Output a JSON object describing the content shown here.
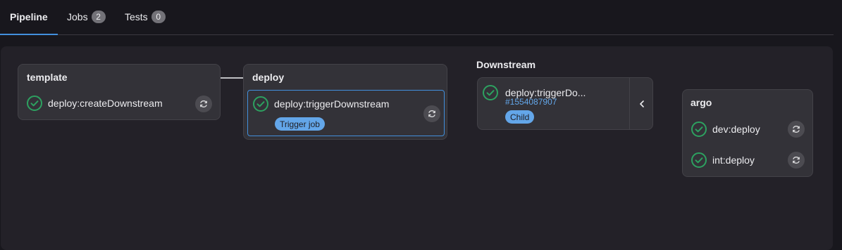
{
  "tabs": [
    {
      "label": "Pipeline",
      "active": true
    },
    {
      "label": "Jobs",
      "count": "2"
    },
    {
      "label": "Tests",
      "count": "0"
    }
  ],
  "stages": {
    "template": {
      "title": "template",
      "jobs": [
        {
          "label": "deploy:createDownstream",
          "status": "success"
        }
      ]
    },
    "deploy": {
      "title": "deploy",
      "jobs": [
        {
          "label": "deploy:triggerDownstream",
          "status": "success",
          "badge": "Trigger job"
        }
      ]
    },
    "argo": {
      "title": "argo",
      "jobs": [
        {
          "label": "dev:deploy",
          "status": "success"
        },
        {
          "label": "int:deploy",
          "status": "success"
        }
      ]
    }
  },
  "downstream": {
    "title": "Downstream",
    "pipeline": {
      "job": "deploy:triggerDo...",
      "id": "#1554087907",
      "badge": "Child",
      "status": "success"
    }
  },
  "icons": {
    "status": "status-success-icon",
    "retry": "retry-icon",
    "collapse": "chevron-left-icon"
  },
  "colors": {
    "success": "#2da160",
    "accent": "#428fdc",
    "link": "#63a6e9"
  }
}
